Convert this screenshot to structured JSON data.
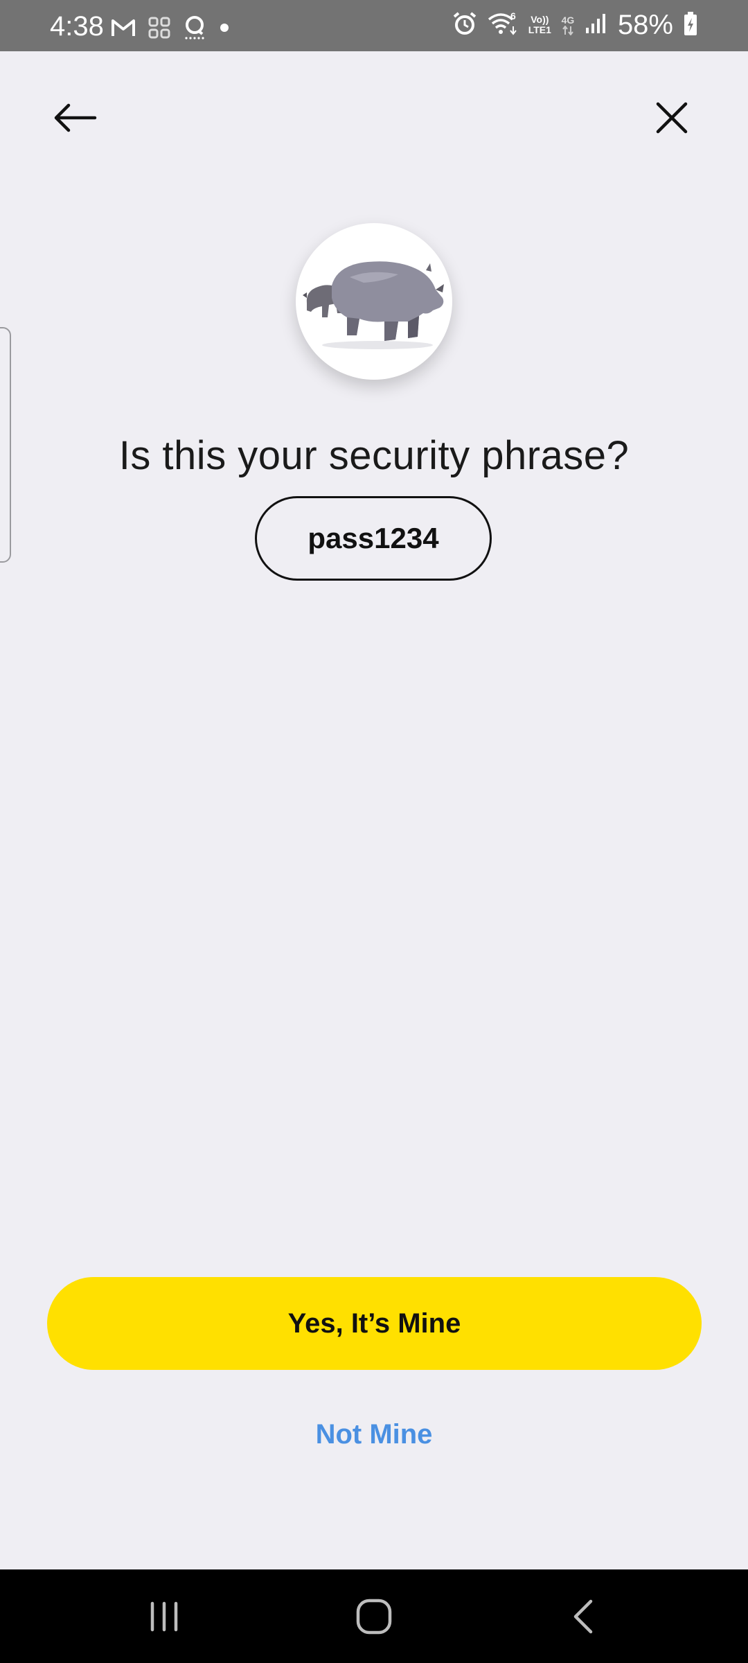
{
  "status_bar": {
    "time": "4:38",
    "battery_percent": "58%",
    "volte_label_top": "Vo))",
    "volte_label_bottom": "LTE1",
    "network_label": "4G",
    "wifi_badge": "6",
    "left_icons": [
      "gmail-icon",
      "app-grid-icon",
      "chat-icon",
      "notification-dot-icon"
    ],
    "right_icons": [
      "alarm-icon",
      "wifi-icon",
      "volte-icon",
      "network-4g-icon",
      "signal-icon",
      "battery-charging-icon"
    ]
  },
  "nav": {
    "back_icon": "arrow-left-icon",
    "close_icon": "close-icon"
  },
  "content": {
    "avatar_image": "rhinoceros-image",
    "heading": "Is this your security phrase?",
    "security_phrase": "pass1234"
  },
  "actions": {
    "confirm_label": "Yes, It’s Mine",
    "deny_label": "Not Mine"
  },
  "colors": {
    "background": "#efeef3",
    "primary": "#ffe000",
    "link": "#4a90e2",
    "status_bar": "#737373"
  },
  "system_nav": {
    "recents_icon": "recents-icon",
    "home_icon": "home-icon",
    "back_icon": "back-chevron-icon"
  }
}
